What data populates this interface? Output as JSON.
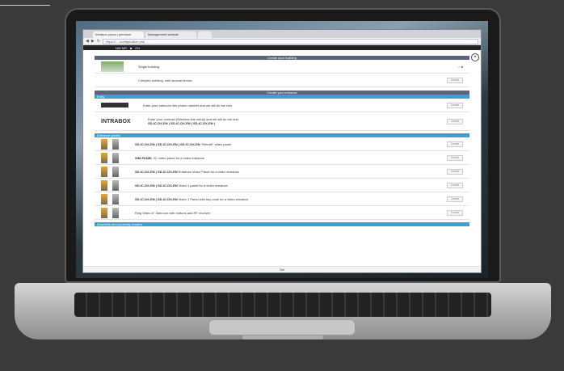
{
  "browser": {
    "tabs": [
      {
        "label": "Intrabox prova | premium"
      },
      {
        "label": "Management website"
      },
      {
        "label": ""
      }
    ],
    "nav": {
      "back": "◀",
      "forward": "▶",
      "reload": "↻"
    },
    "url": "https://... /configuration.php",
    "appbar": [
      "NW MR",
      "■",
      "EN"
    ]
  },
  "page": {
    "close_glyph": "×",
    "section_building": "Create your building",
    "building_rows": [
      {
        "text": "Single building",
        "radio": "○ ●"
      },
      {
        "text": "Complex building, with several blocks",
        "button": "Create"
      }
    ],
    "section_entrance": "Create your entrance",
    "entrance_tab": "Entry",
    "entrance_rows": [
      {
        "text": "Enter your intercom line phone number and we will do the rest",
        "button": "Create"
      },
      {
        "text_main": "Enter your contract (Wireless line setup) and we will do the rest",
        "text_extra": "SD-IC-DX-EN  |  SD-IC-DX-EN  |  SD-IC-DX-EN  |",
        "button": "Create"
      }
    ],
    "entrance_logo": "INTRABOX",
    "entrance_panel_tab": "Entrance panels",
    "panel_rows": [
      {
        "code": "SD-IC-DX-EN | SD-IC-DX-EN | SD-IC-DX-EN",
        "text": "\"Retrofit\" video panel",
        "button": "Create"
      },
      {
        "code": "WM-PANEL",
        "text": "2C video panel for a video entrance",
        "button": "Create"
      },
      {
        "code": "SD-IC-DX-EN | SD-IC-DX-EN",
        "text": "Entrance Video Panel for a video entrance",
        "button": "Create"
      },
      {
        "code": "SD-IC-DX-EN | SD-IC-DX-EN",
        "text": "Video 1 panel for a video entrance",
        "button": "Create"
      },
      {
        "code": "SD-IC-DX-EN | SD-IC-DX-EN",
        "text": "Video 1 Panel with key code for a video entrance",
        "button": "Create"
      },
      {
        "code": "",
        "text": "Ring Video A\" Intercom with buttons and RF receiver",
        "button": "Create"
      }
    ],
    "bottom_tab": "Doorbells and proximity readers",
    "footer": "Set"
  },
  "colors": {
    "header_dark": "#5a6677",
    "accent_blue": "#39a0cf",
    "panel_gold": "#e8a833"
  }
}
